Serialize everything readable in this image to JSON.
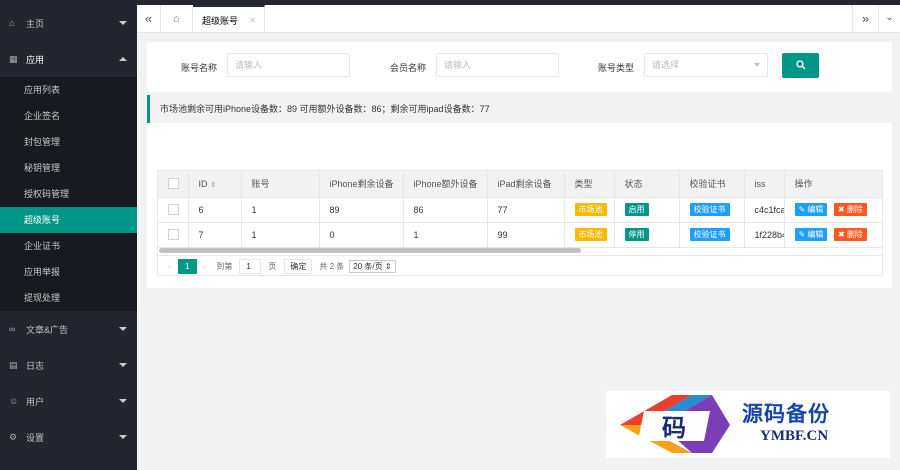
{
  "sidebar": {
    "home": "主页",
    "app": "应用",
    "app_items": [
      "应用列表",
      "企业签名",
      "封包管理",
      "秘钥管理",
      "授权码管理",
      "超级账号",
      "企业证书",
      "应用举报",
      "提现处理"
    ],
    "article": "文章&广告",
    "log": "日志",
    "user": "用户",
    "settings": "设置"
  },
  "tabs": {
    "active": "超级账号"
  },
  "search": {
    "account_label": "账号名称",
    "account_placeholder": "请输入",
    "member_label": "会员名称",
    "member_placeholder": "请输入",
    "type_label": "账号类型",
    "type_placeholder": "请选择"
  },
  "notice": "市场池剩余可用iPhone设备数：89 可用额外设备数：86；剩余可用ipad设备数：77",
  "table": {
    "headers": [
      "ID",
      "账号",
      "iPhone剩余设备",
      "iPhone额外设备",
      "iPad剩余设备",
      "类型",
      "状态",
      "校验证书",
      "iss",
      "操作"
    ],
    "rows": [
      {
        "id": "6",
        "account": "1",
        "iphone_left": "89",
        "iphone_extra": "86",
        "ipad_left": "77",
        "type": "市场池",
        "status": "启用",
        "cert": "校验证书",
        "iss": "c4c1fca",
        "edit": "编辑",
        "del": "删除"
      },
      {
        "id": "7",
        "account": "1",
        "iphone_left": "0",
        "iphone_extra": "1",
        "ipad_left": "99",
        "type": "市场池",
        "status": "停用",
        "cert": "校验证书",
        "iss": "1f228b4",
        "edit": "编辑",
        "del": "删除"
      }
    ]
  },
  "pager": {
    "current": "1",
    "goto": "到第",
    "page_value": "1",
    "page_unit": "页",
    "confirm": "确定",
    "total": "共 2 条",
    "size": "20 条/页"
  },
  "watermark": {
    "title": "源码备份",
    "url": "YMBF.CN",
    "glyph": "码"
  },
  "colors": {
    "sidebar": "#23262e",
    "accent": "#009688",
    "orange": "#ffb800",
    "blue": "#1e9fff",
    "red": "#ff5722"
  }
}
